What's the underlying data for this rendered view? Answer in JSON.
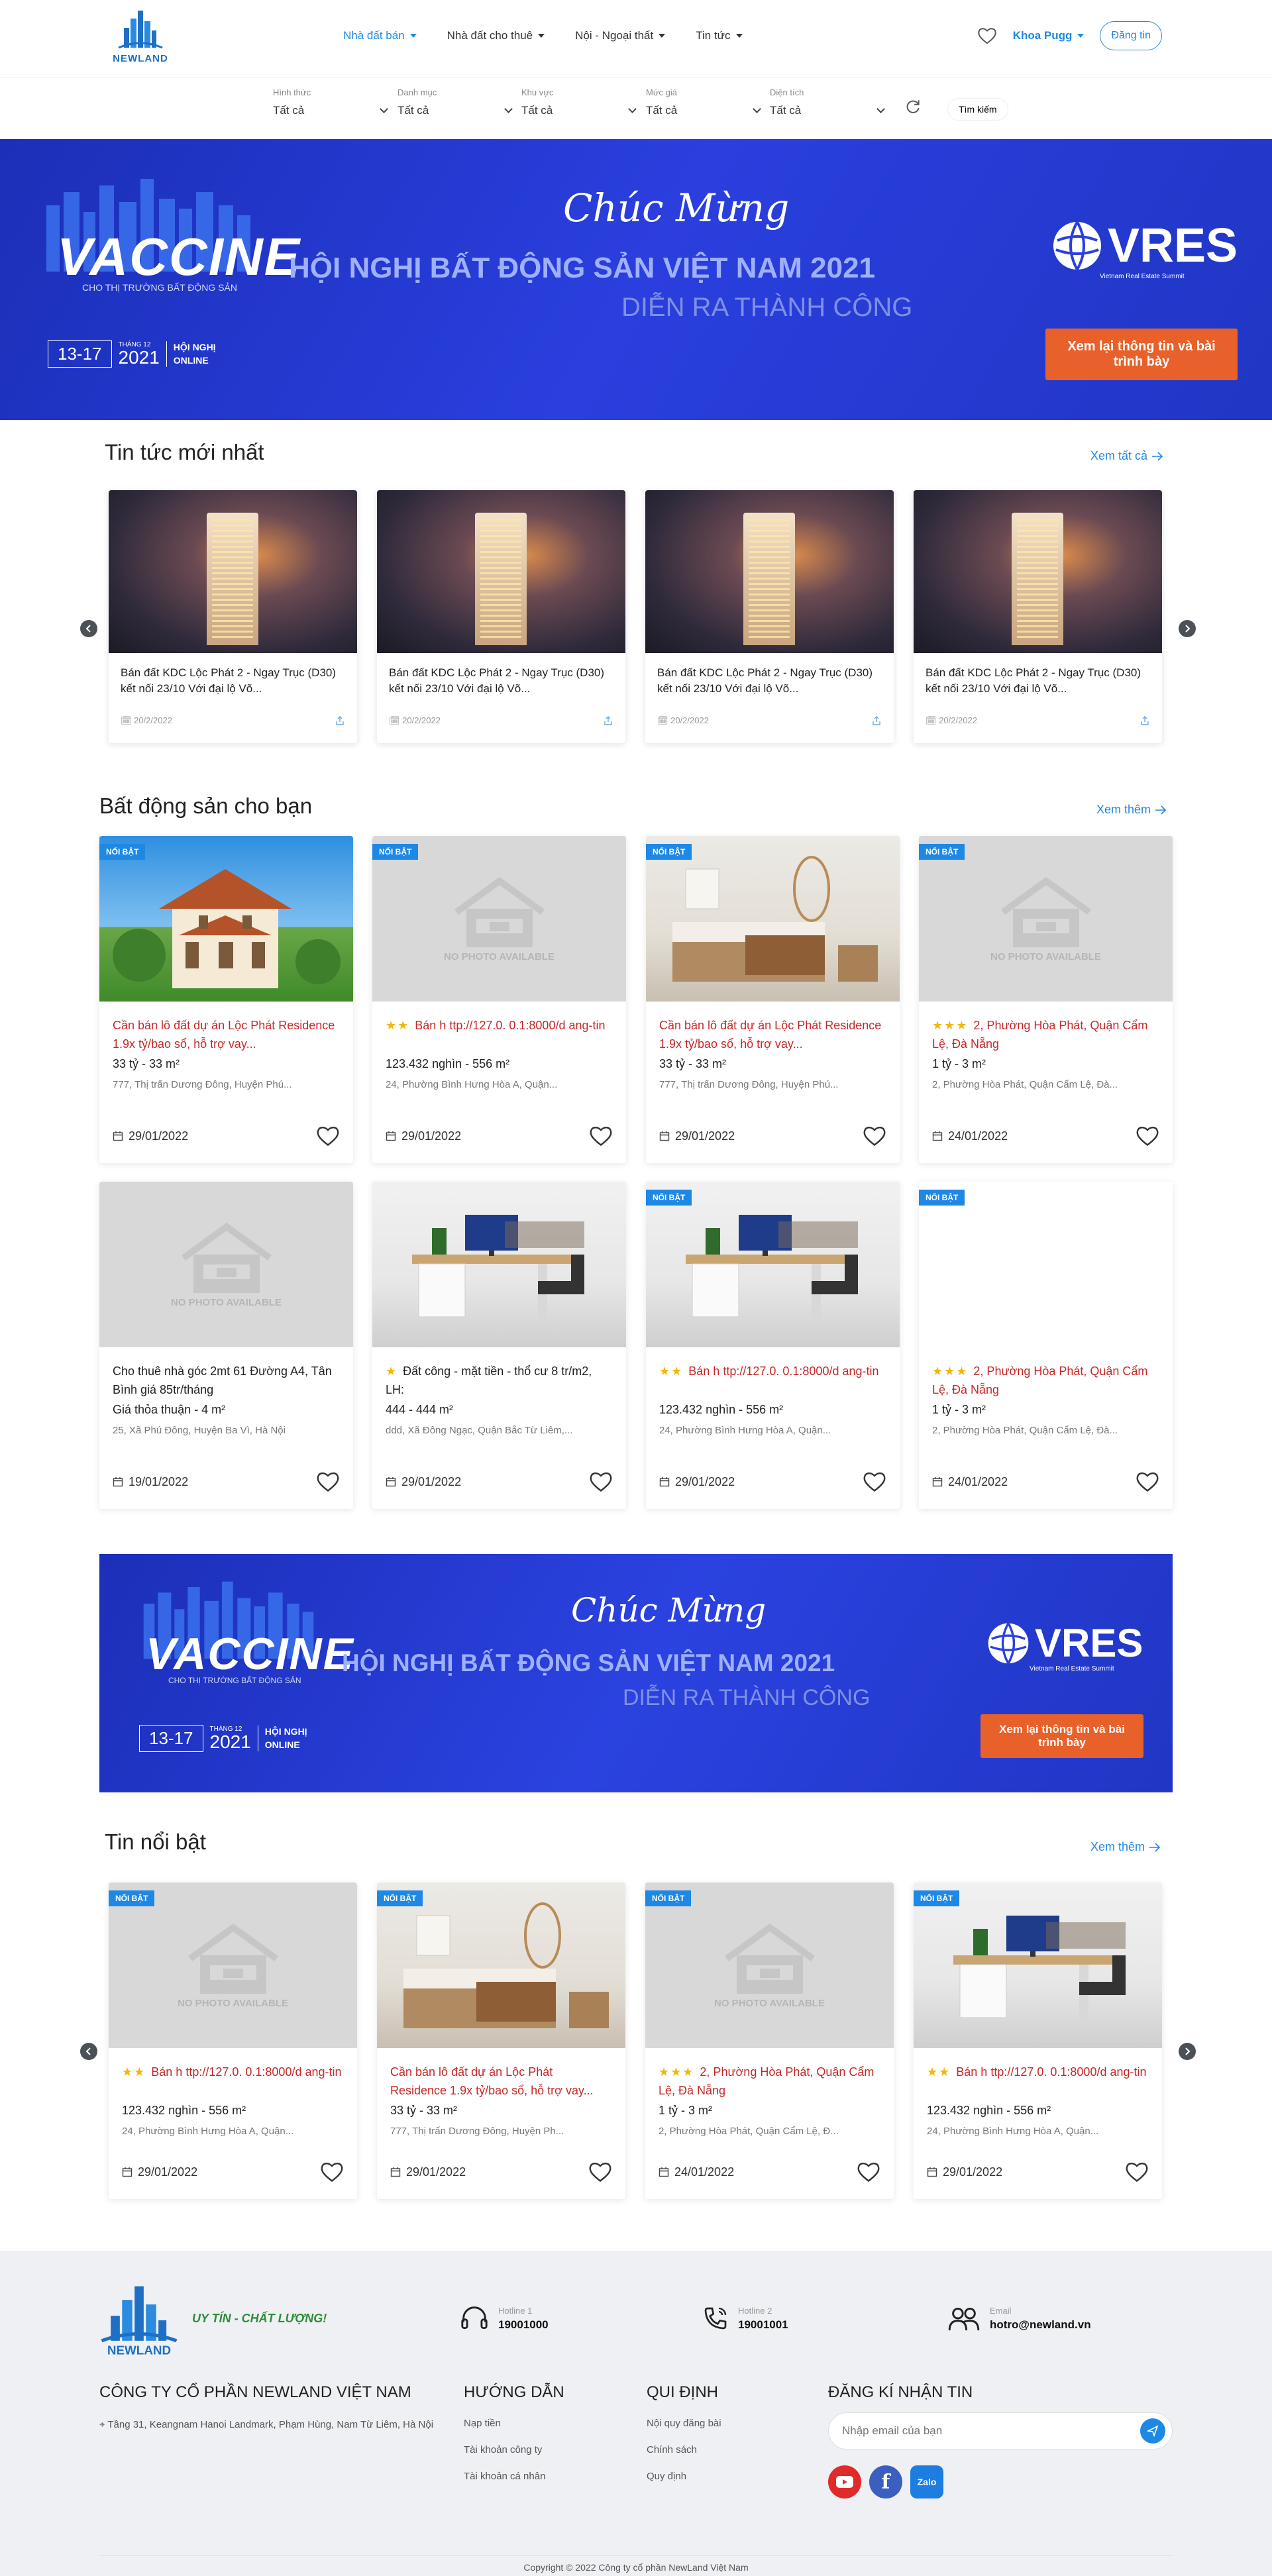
{
  "header": {
    "logo_text": "NEWLAND",
    "nav": [
      {
        "label": "Nhà đất bán",
        "active": true
      },
      {
        "label": "Nhà đất cho thuê",
        "active": false
      },
      {
        "label": "Nội - Ngoại thất",
        "active": false
      },
      {
        "label": "Tin tức",
        "active": false
      }
    ],
    "user_name": "Khoa Pugg",
    "login_label": "Đăng tin"
  },
  "filters": [
    {
      "label": "Hình thức",
      "value": "Tất cả"
    },
    {
      "label": "Danh mục",
      "value": "Tất cả"
    },
    {
      "label": "Khu vực",
      "value": "Tất cả"
    },
    {
      "label": "Mức giá",
      "value": "Tất cả"
    },
    {
      "label": "Diện tích",
      "value": "Tất cả"
    }
  ],
  "search_label": "Tìm kiếm",
  "banner": {
    "vaccine": "VACCINE",
    "vaccine_sub": "CHO THỊ TRƯỜNG BẤT ĐỘNG SẢN",
    "dates": "13-17",
    "month": "THÁNG 12",
    "year": "2021",
    "online": "HỘI NGHỊ ONLINE",
    "greeting": "Chúc Mừng",
    "headline": "HỘI NGHỊ BẤT ĐỘNG SẢN VIỆT NAM 2021",
    "subline": "DIỄN RA THÀNH CÔNG",
    "brand": "VRES",
    "brand_sub": "Vietnam Real Estate Summit",
    "cta": "Xem lại thông tin và bài trình bày"
  },
  "news": {
    "title": "Tin tức mới nhất",
    "see_all": "Xem tất cả",
    "items": [
      {
        "title": "Bán đất KDC Lộc Phát 2 - Ngay Trục (D30) kết nối 23/10 Với đại lộ Võ...",
        "date": "20/2/2022"
      },
      {
        "title": "Bán đất KDC Lộc Phát 2 - Ngay Trục (D30) kết nối 23/10 Với đại lộ Võ...",
        "date": "20/2/2022"
      },
      {
        "title": "Bán đất KDC Lộc Phát 2 - Ngay Trục (D30) kết nối 23/10 Với đại lộ Võ...",
        "date": "20/2/2022"
      },
      {
        "title": "Bán đất KDC Lộc Phát 2 - Ngay Trục (D30) kết nối 23/10 Với đại lộ Võ...",
        "date": "20/2/2022"
      }
    ]
  },
  "properties": {
    "title": "Bất động sản cho bạn",
    "see_more": "Xem thêm",
    "badge": "NỔI BẬT",
    "no_photo": "NO PHOTO AVAILABLE",
    "items": [
      {
        "img": "villa",
        "featured": true,
        "stars": "",
        "title": "Cần bán lô đất dự án Lộc Phát Residence 1.9x tỷ/bao sổ, hỗ trợ vay...",
        "red": true,
        "price": "33 tỷ - 33 m²",
        "addr": "777, Thị trấn Dương Đông, Huyện Phú...",
        "date": "29/01/2022"
      },
      {
        "img": "nophoto",
        "featured": true,
        "stars": "★★",
        "title": "Bán h ttp://127.0. 0.1:8000/d ang-tin",
        "red": true,
        "price": "123.432 nghìn - 556 m²",
        "addr": "24, Phường Bình Hưng Hòa A, Quận...",
        "date": "29/01/2022"
      },
      {
        "img": "bedroom",
        "featured": true,
        "stars": "",
        "title": "Cần bán lô đất dự án Lộc Phát Residence 1.9x tỷ/bao sổ, hỗ trợ vay...",
        "red": true,
        "price": "33 tỷ - 33 m²",
        "addr": "777, Thị trấn Dương Đông, Huyện Phú...",
        "date": "29/01/2022"
      },
      {
        "img": "nophoto",
        "featured": true,
        "stars": "★★★",
        "title": "2, Phường Hòa Phát, Quận Cẩm Lệ, Đà Nẵng",
        "red": true,
        "price": "1 tỷ - 3 m²",
        "addr": "2, Phường Hòa Phát, Quận Cẩm Lệ, Đà...",
        "date": "24/01/2022"
      },
      {
        "img": "nophoto",
        "featured": false,
        "stars": "",
        "title": "Cho thuê nhà góc 2mt 61 Đường A4, Tân Bình giá 85tr/tháng",
        "red": false,
        "price": "Giá thỏa thuận - 4 m²",
        "addr": "25, Xã Phú Đông, Huyện Ba Vì, Hà Nội",
        "date": "19/01/2022"
      },
      {
        "img": "office",
        "featured": false,
        "stars": "★",
        "title": "Đất công - mặt tiền - thổ cư 8 tr/m2, LH:",
        "red": false,
        "price": "444 - 444 m²",
        "addr": "ddd, Xã Đông Ngạc, Quận Bắc Từ Liêm,...",
        "date": "29/01/2022"
      },
      {
        "img": "office",
        "featured": true,
        "stars": "★★",
        "title": "Bán h ttp://127.0. 0.1:8000/d ang-tin",
        "red": true,
        "price": "123.432 nghìn - 556 m²",
        "addr": "24, Phường Bình Hưng Hòa A, Quận...",
        "date": "29/01/2022"
      },
      {
        "img": "blank",
        "featured": true,
        "stars": "★★★",
        "title": "2, Phường Hòa Phát, Quận Cẩm Lệ, Đà Nẵng",
        "red": true,
        "price": "1 tỷ - 3 m²",
        "addr": "2, Phường Hòa Phát, Quận Cẩm Lệ, Đà...",
        "date": "24/01/2022"
      }
    ]
  },
  "hot": {
    "title": "Tin nổi bật",
    "see_more": "Xem thêm",
    "items": [
      {
        "img": "nophoto",
        "stars": "★★",
        "title": "Bán h ttp://127.0. 0.1:8000/d ang-tin",
        "price": "123.432 nghìn - 556 m²",
        "addr": "24, Phường Bình Hưng Hòa A, Quận...",
        "date": "29/01/2022"
      },
      {
        "img": "bedroom",
        "stars": "",
        "title": "Cần bán lô đất dự án Lộc Phát Residence 1.9x tỷ/bao sổ, hỗ trợ vay...",
        "price": "33 tỷ - 33 m²",
        "addr": "777, Thị trấn Dương Đông, Huyện Ph...",
        "date": "29/01/2022"
      },
      {
        "img": "nophoto",
        "stars": "★★★",
        "title": "2, Phường Hòa Phát, Quận Cẩm Lệ, Đà Nẵng",
        "price": "1 tỷ - 3 m²",
        "addr": "2, Phường Hòa Phát, Quận Cẩm Lệ, Đ...",
        "date": "24/01/2022"
      },
      {
        "img": "office",
        "stars": "★★",
        "title": "Bán h ttp://127.0. 0.1:8000/d ang-tin",
        "price": "123.432 nghìn - 556 m²",
        "addr": "24, Phường Bình Hưng Hòa A, Quận...",
        "date": "29/01/2022"
      }
    ]
  },
  "footer": {
    "slogan": "UY TÍN - CHẤT LƯỢNG!",
    "hotline1_label": "Hotline 1",
    "hotline1": "19001000",
    "hotline2_label": "Hotline 2",
    "hotline2": "19001001",
    "email_label": "Email",
    "email": "hotro@newland.vn",
    "company": "CÔNG TY CỔ PHẦN NEWLAND VIỆT NAM",
    "address": "Tầng 31, Keangnam Hanoi Landmark, Phạm Hùng, Nam Từ Liêm, Hà Nội",
    "guide_title": "HƯỚNG DẪN",
    "guide_links": [
      "Nạp tiền",
      "Tài khoản công ty",
      "Tài khoản cá nhân"
    ],
    "rules_title": "QUI ĐỊNH",
    "rules_links": [
      "Nội quy đăng bài",
      "Chính sách",
      "Quy định"
    ],
    "subscribe_title": "ĐĂNG KÍ NHẬN TIN",
    "subscribe_placeholder": "Nhập email của bạn",
    "social": [
      "YouTube",
      "Facebook",
      "Zalo"
    ],
    "copyright": "Copyright © 2022 Công ty cổ phần NewLand Việt Nam"
  }
}
